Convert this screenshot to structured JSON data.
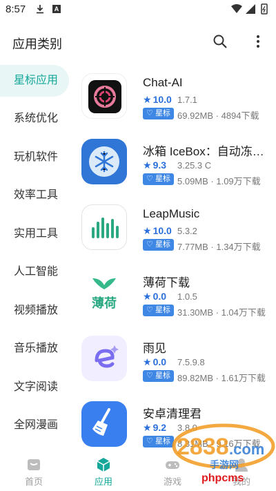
{
  "status_bar": {
    "time": "8:57"
  },
  "header": {
    "title": "应用类别"
  },
  "sidebar": {
    "items": [
      {
        "label": "星标应用",
        "active": true
      },
      {
        "label": "系统优化"
      },
      {
        "label": "玩机软件"
      },
      {
        "label": "效率工具"
      },
      {
        "label": "实用工具"
      },
      {
        "label": "人工智能"
      },
      {
        "label": "视频播放"
      },
      {
        "label": "音乐播放"
      },
      {
        "label": "文字阅读"
      },
      {
        "label": "全网漫画"
      }
    ]
  },
  "apps": [
    {
      "name": "Chat-AI",
      "rating": "10.0",
      "version": "1.7.1",
      "badge": "星标",
      "meta": "69.92MB · 4894下载",
      "icon": "chat-ai-icon"
    },
    {
      "name": "冰箱 IceBox：自动冻结…",
      "rating": "9.3",
      "version": "3.25.3 C",
      "badge": "星标",
      "meta": "5.09MB · 1.09万下载",
      "icon": "icebox-icon"
    },
    {
      "name": "LeapMusic",
      "rating": "10.0",
      "version": "5.3.2",
      "badge": "星标",
      "meta": "7.77MB · 1.34万下载",
      "icon": "leapmusic-icon"
    },
    {
      "name": "薄荷下载",
      "rating": "0.0",
      "version": "1.0.5",
      "badge": "星标",
      "meta": "31.30MB · 1.04万下载",
      "icon": "mint-download-icon",
      "icon_text": "薄荷"
    },
    {
      "name": "雨见",
      "rating": "0.0",
      "version": "7.5.9.8",
      "badge": "星标",
      "meta": "89.82MB · 1.61万下载",
      "icon": "yujian-icon"
    },
    {
      "name": "安卓清理君",
      "rating": "9.2",
      "version": "3.8.0",
      "badge": "星标",
      "meta": "8.31MB · 9.16万下载",
      "icon": "cleaner-icon"
    }
  ],
  "bottom_nav": [
    {
      "label": "首页",
      "icon": "home-icon"
    },
    {
      "label": "应用",
      "icon": "cube-icon",
      "active": true
    },
    {
      "label": "游戏",
      "icon": "gamepad-icon"
    },
    {
      "label": "我的",
      "icon": "profile-icon"
    }
  ],
  "watermark": {
    "text": "phpcms",
    "logo_text": "2838.com 手游网"
  },
  "colors": {
    "accent": "#14a79a",
    "rating": "#2a6fdb",
    "badge": "#3f87e5",
    "active_bg": "#e8f6f5"
  }
}
